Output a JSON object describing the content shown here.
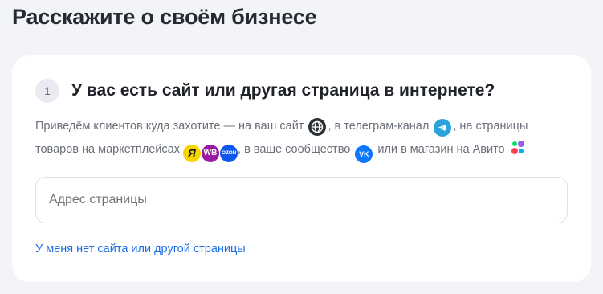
{
  "page": {
    "title": "Расскажите о своём бизнесе"
  },
  "question": {
    "step_number": "1",
    "title": "У вас есть сайт или другая страница в интернете?",
    "description": {
      "part1": "Приведём клиентов куда захотите — на ваш сайт",
      "part2": ", в телеграм-канал",
      "part3": ", на страницы товаров на маркетплейсах",
      "part4": ", в ваше сообщество",
      "part5": "или в магазин на Авито"
    },
    "icons": {
      "ymarket_letter": "Я",
      "wb_letters": "WB",
      "ozon_letters": "OZON",
      "vk_letters": "VK"
    }
  },
  "input": {
    "placeholder": "Адрес страницы",
    "value": ""
  },
  "link": {
    "no_site": "У меня нет сайта или другой страницы"
  },
  "colors": {
    "accent_link": "#1b6ee8",
    "telegram": "#2aa3dd",
    "vk": "#0b77ff",
    "wildberries": "#9b1aa1",
    "ozon": "#1057f0",
    "yandex_market": "#f7d500"
  }
}
